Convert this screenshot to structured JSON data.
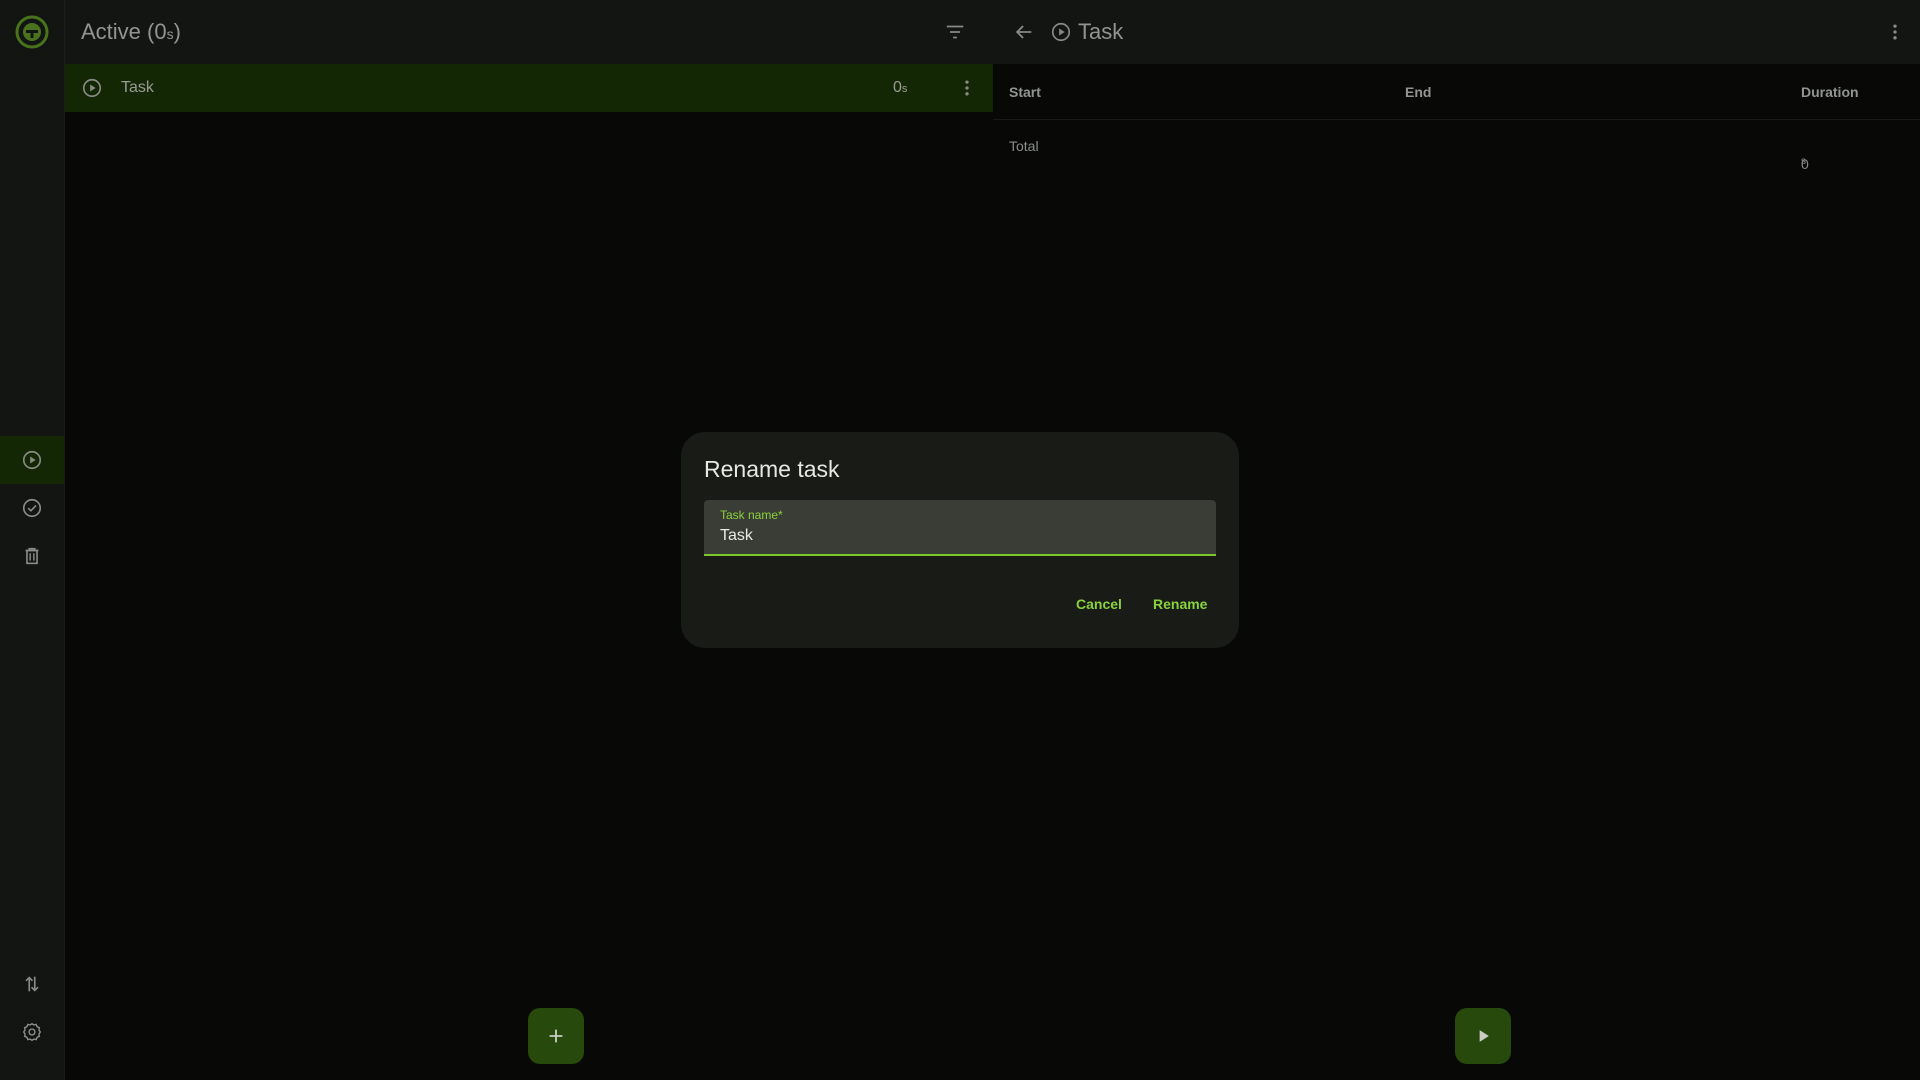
{
  "colors": {
    "accent": "#8ad23c",
    "selected_row": "#1e3a06",
    "surface": "#1d1f1b",
    "background": "#0c0e0b"
  },
  "sidebar": {
    "logo_icon": "timer-logo-icon",
    "items": [
      {
        "icon": "play-circle-icon",
        "active": true
      },
      {
        "icon": "check-circle-icon",
        "active": false
      },
      {
        "icon": "trash-icon",
        "active": false
      }
    ],
    "bottom_items": [
      {
        "icon": "import-export-icon"
      },
      {
        "icon": "settings-icon"
      }
    ]
  },
  "left_pane": {
    "title": "Active (0",
    "title_unit": "s",
    "title_suffix": ")",
    "tasks": [
      {
        "name": "Task",
        "duration": "0",
        "duration_unit": "s"
      }
    ]
  },
  "right_pane": {
    "title": "Task",
    "table": {
      "headers": {
        "start": "Start",
        "end": "End",
        "duration": "Duration"
      },
      "total_label": "Total",
      "total_value": "0",
      "total_unit": "s"
    }
  },
  "dialog": {
    "title": "Rename task",
    "field_label": "Task name*",
    "field_value": "Task",
    "cancel_label": "Cancel",
    "rename_label": "Rename"
  }
}
